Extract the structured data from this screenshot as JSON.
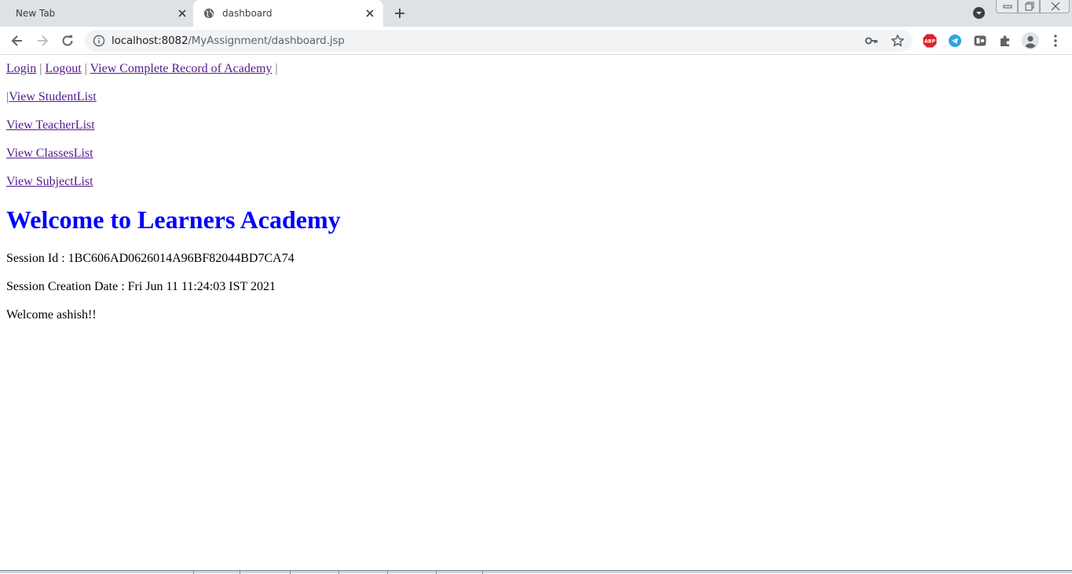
{
  "browser": {
    "tabs": [
      {
        "title": "New Tab",
        "active": false
      },
      {
        "title": "dashboard",
        "active": true
      }
    ],
    "address": {
      "host": "localhost:8082",
      "path": "/MyAssignment/dashboard.jsp"
    },
    "extensions": {
      "abp_label": "ABP"
    }
  },
  "nav": {
    "login": "Login",
    "logout": "Logout",
    "record": "View Complete Record of Academy",
    "separator": "|",
    "student_prefix": "|",
    "student": "View StudentList",
    "teacher": "View TeacherList",
    "classes": "View ClassesList",
    "subject": "View SubjectList"
  },
  "main": {
    "heading": "Welcome to Learners Academy",
    "session_id": "Session Id : 1BC606AD0626014A96BF82044BD7CA74",
    "session_date": "Session Creation Date : Fri Jun 11 11:24:03 IST 2021",
    "welcome": "Welcome ashish!!"
  },
  "colors": {
    "heading": "#0000ff",
    "link": "#551a8b",
    "tabstrip": "#dee1e6",
    "omnibox": "#f1f3f4",
    "abp_badge": "#e0202a",
    "telegram": "#2ca5e0"
  },
  "icons": {
    "tab_favicon": "globe-icon",
    "tab_close": "close-icon",
    "new_tab": "plus-icon",
    "back": "arrow-left-icon",
    "forward": "arrow-right-icon",
    "reload": "reload-icon",
    "site_info": "info-icon",
    "passwords": "key-icon",
    "bookmark": "star-icon",
    "extensions": "puzzle-icon",
    "profile": "avatar-icon",
    "menu": "kebab-menu-icon"
  }
}
